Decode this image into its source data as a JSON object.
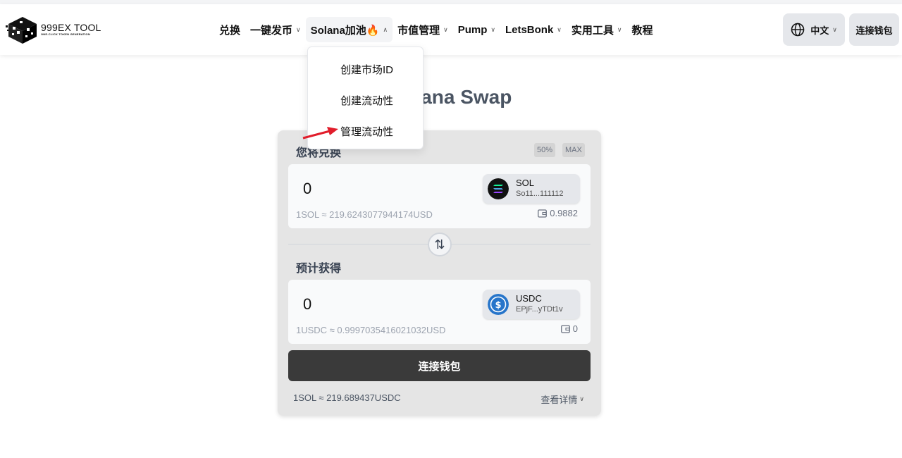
{
  "logo": {
    "title": "999EX TOOL",
    "subtitle": "ONE-CLICK TOKEN GENERATION"
  },
  "nav": {
    "items": [
      {
        "label": "兑换",
        "has_chevron": false
      },
      {
        "label": "一键发币",
        "has_chevron": true
      },
      {
        "label": "Solana加池🔥",
        "has_chevron": true,
        "expanded": true
      },
      {
        "label": "市值管理",
        "has_chevron": true
      },
      {
        "label": "Pump",
        "has_chevron": true
      },
      {
        "label": "LetsBonk",
        "has_chevron": true
      },
      {
        "label": "实用工具",
        "has_chevron": true
      },
      {
        "label": "教程",
        "has_chevron": false
      }
    ],
    "chevron_down": "⌄",
    "chevron_up": "^"
  },
  "header_right": {
    "language": "中文",
    "connect_wallet": "连接钱包"
  },
  "dropdown": {
    "items": [
      "创建市场ID",
      "创建流动性",
      "管理流动性"
    ]
  },
  "page": {
    "title": "Solana Swap"
  },
  "swap": {
    "from": {
      "label": "您将兑换",
      "pill_half": "50%",
      "pill_max": "MAX",
      "amount": "0",
      "token_symbol": "SOL",
      "token_address": "So11...111112",
      "rate": "1SOL ≈ 219.6243077944174USD",
      "balance": "0.9882"
    },
    "to": {
      "label": "预计获得",
      "amount": "0",
      "token_symbol": "USDC",
      "token_address": "EPjF...yTDt1v",
      "rate": "1USDC ≈ 0.9997035416021032USD",
      "balance": "0"
    },
    "swap_icon": "⇅",
    "connect_button": "连接钱包",
    "footer_rate": "1SOL ≈ 219.689437USDC",
    "details_label": "查看详情"
  },
  "colors": {
    "arrow": "#e11d2b",
    "usdc": "#2775ca",
    "sol_bg": "#111111"
  }
}
